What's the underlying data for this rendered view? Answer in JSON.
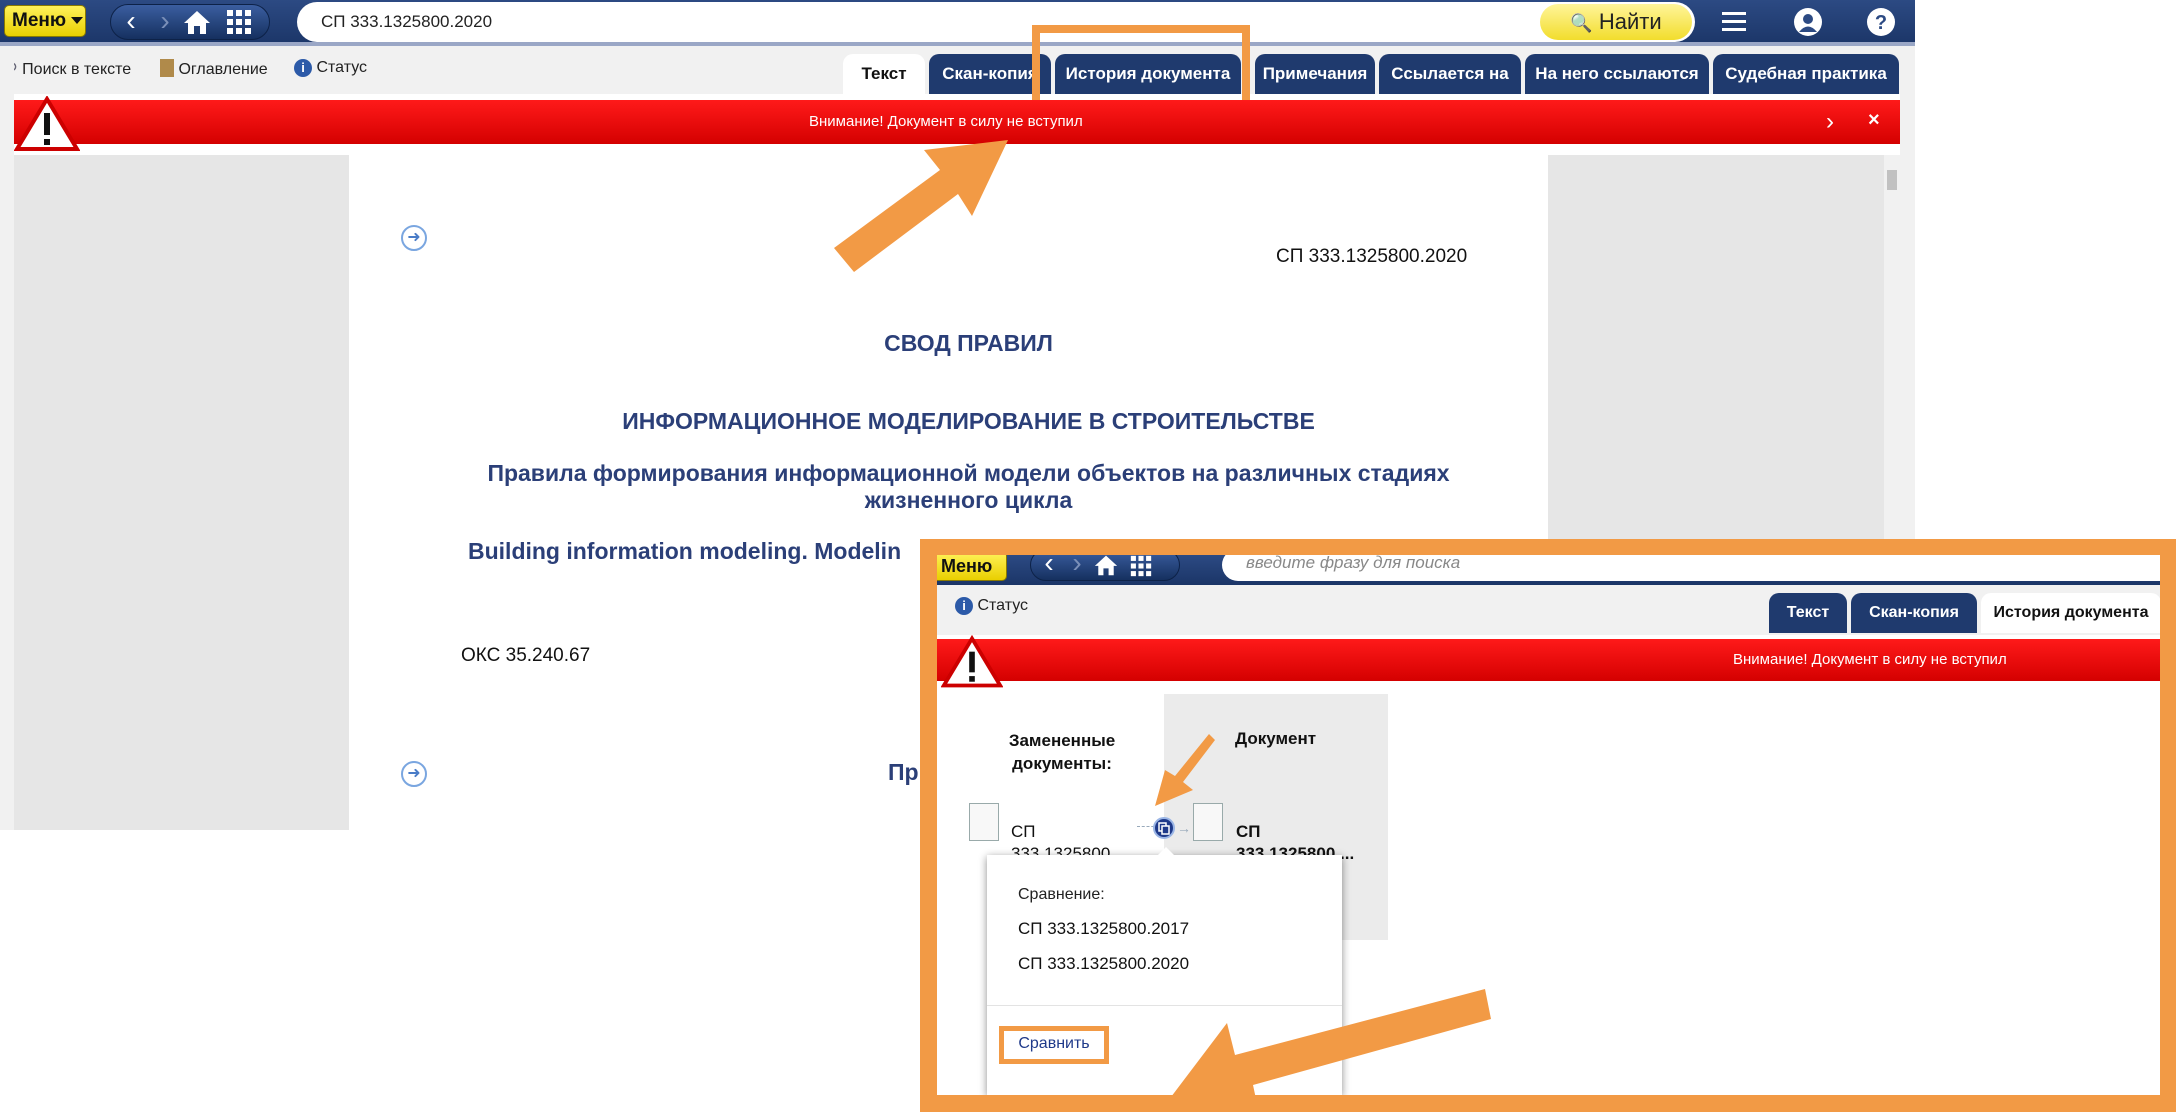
{
  "header": {
    "menu_label": "Меню",
    "search_value": "СП 333.1325800.2020",
    "find_label": "Найти",
    "icons": {
      "back": "chevron-left-icon",
      "forward": "chevron-right-icon",
      "home": "home-icon",
      "apps": "grid-icon",
      "hamburger": "menu-icon",
      "user": "user-icon",
      "help": "help-icon"
    }
  },
  "toolbar": {
    "search_in_text": "Поиск в тексте",
    "contents": "Оглавление",
    "status": "Статус"
  },
  "tabs": [
    {
      "label": "Текст",
      "active": true
    },
    {
      "label": "Скан-копия"
    },
    {
      "label": "История документа",
      "highlighted": true
    },
    {
      "label": "Примечания"
    },
    {
      "label": "Ссылается на"
    },
    {
      "label": "На него ссылаются"
    },
    {
      "label": "Судебная практика"
    }
  ],
  "warning": {
    "text": "Внимание! Документ в силу не вступил"
  },
  "document": {
    "code": "СП 333.1325800.2020",
    "heading": "СВОД ПРАВИЛ",
    "title": "ИНФОРМАЦИОННОЕ МОДЕЛИРОВАНИЕ В СТРОИТЕЛЬСТВЕ",
    "subtitle_line1": "Правила формирования информационной модели объектов на различных стадиях",
    "subtitle_line2": "жизненного цикла",
    "english": "Building information modeling. Modelin",
    "oks": "ОКС 35.240.67",
    "fragment": "Пр"
  },
  "inset": {
    "menu_label": "Меню",
    "search_placeholder": "введите фразу для поиска",
    "status": "Статус",
    "tabs": [
      {
        "label": "Текст"
      },
      {
        "label": "Скан-копия"
      },
      {
        "label": "История документа",
        "active": true
      }
    ],
    "warning_text": "Внимание! Документ в силу не вступил",
    "replaced_header_1": "Замененные",
    "replaced_header_2": "документы:",
    "document_header": "Документ",
    "replaced_doc_1": "СП",
    "replaced_doc_2": "333.1325800...",
    "current_doc_1": "СП",
    "current_doc_2": "333.1325800....",
    "popup": {
      "title": "Сравнение:",
      "item1": "СП 333.1325800.2017",
      "item2": "СП 333.1325800.2020",
      "button": "Сравнить"
    }
  },
  "colors": {
    "accent_orange": "#f29a45",
    "nav_blue": "#1f3a6e",
    "warning_red": "#e00000",
    "doc_text_blue": "#2b3f78",
    "find_yellow": "#f5e33c"
  }
}
